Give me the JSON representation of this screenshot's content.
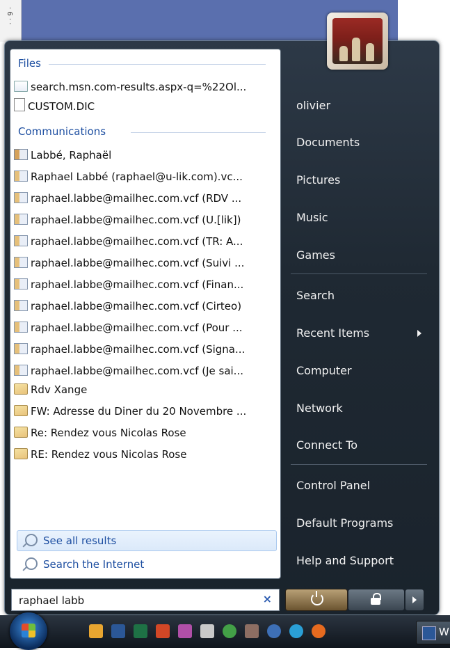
{
  "background_window": {
    "ruler_text": "· 6 · ·"
  },
  "left_pane": {
    "files_header": "Files",
    "files": [
      {
        "icon": "web-page-icon",
        "label": "search.msn.com-results.aspx-q=%22Ol..."
      },
      {
        "icon": "document-icon",
        "label": "CUSTOM.DIC"
      }
    ],
    "communications_header": "Communications",
    "communications": [
      {
        "icon": "contact-card-icon",
        "label": "Labbé, Raphaël"
      },
      {
        "icon": "vcard-icon",
        "label": "Raphael Labbé (raphael@u-lik.com).vc..."
      },
      {
        "icon": "vcard-icon",
        "label": "raphael.labbe@mailhec.com.vcf (RDV ..."
      },
      {
        "icon": "vcard-icon",
        "label": "raphael.labbe@mailhec.com.vcf (U.[lik])"
      },
      {
        "icon": "vcard-icon",
        "label": "raphael.labbe@mailhec.com.vcf (TR: A..."
      },
      {
        "icon": "vcard-icon",
        "label": "raphael.labbe@mailhec.com.vcf (Suivi ..."
      },
      {
        "icon": "vcard-icon",
        "label": "raphael.labbe@mailhec.com.vcf (Finan..."
      },
      {
        "icon": "vcard-icon",
        "label": "raphael.labbe@mailhec.com.vcf (Cirteo)"
      },
      {
        "icon": "vcard-icon",
        "label": "raphael.labbe@mailhec.com.vcf (Pour ..."
      },
      {
        "icon": "vcard-icon",
        "label": "raphael.labbe@mailhec.com.vcf (Signa..."
      },
      {
        "icon": "vcard-icon",
        "label": "raphael.labbe@mailhec.com.vcf (Je sai..."
      },
      {
        "icon": "email-icon",
        "label": "Rdv Xange"
      },
      {
        "icon": "email-icon",
        "label": "FW: Adresse du Diner du 20 Novembre ..."
      },
      {
        "icon": "email-icon",
        "label": "Re: Rendez vous Nicolas Rose"
      },
      {
        "icon": "email-icon",
        "label": "RE: Rendez vous Nicolas Rose"
      }
    ],
    "see_all_label": "See all results",
    "search_internet_label": "Search the Internet"
  },
  "search": {
    "value": "raphael labb",
    "clear_symbol": "×"
  },
  "right_pane": {
    "items": [
      {
        "label": "olivier"
      },
      {
        "label": "Documents"
      },
      {
        "label": "Pictures"
      },
      {
        "label": "Music"
      },
      {
        "label": "Games"
      },
      {
        "label": "Search"
      },
      {
        "label": "Recent Items",
        "submenu": true
      },
      {
        "label": "Computer"
      },
      {
        "label": "Network"
      },
      {
        "label": "Connect To"
      },
      {
        "label": "Control Panel"
      },
      {
        "label": "Default Programs"
      },
      {
        "label": "Help and Support"
      }
    ]
  },
  "taskbar": {
    "task_label": "W",
    "quick_launch": [
      "clock-icon",
      "word-icon",
      "excel-icon",
      "powerpoint-icon",
      "paint-icon",
      "stack-icon",
      "globe-icon",
      "tools-icon",
      "messenger-icon",
      "ie-icon",
      "firefox-icon"
    ]
  },
  "colors": {
    "accent": "#1e4fa1",
    "menu_dark": "#1f2933"
  }
}
